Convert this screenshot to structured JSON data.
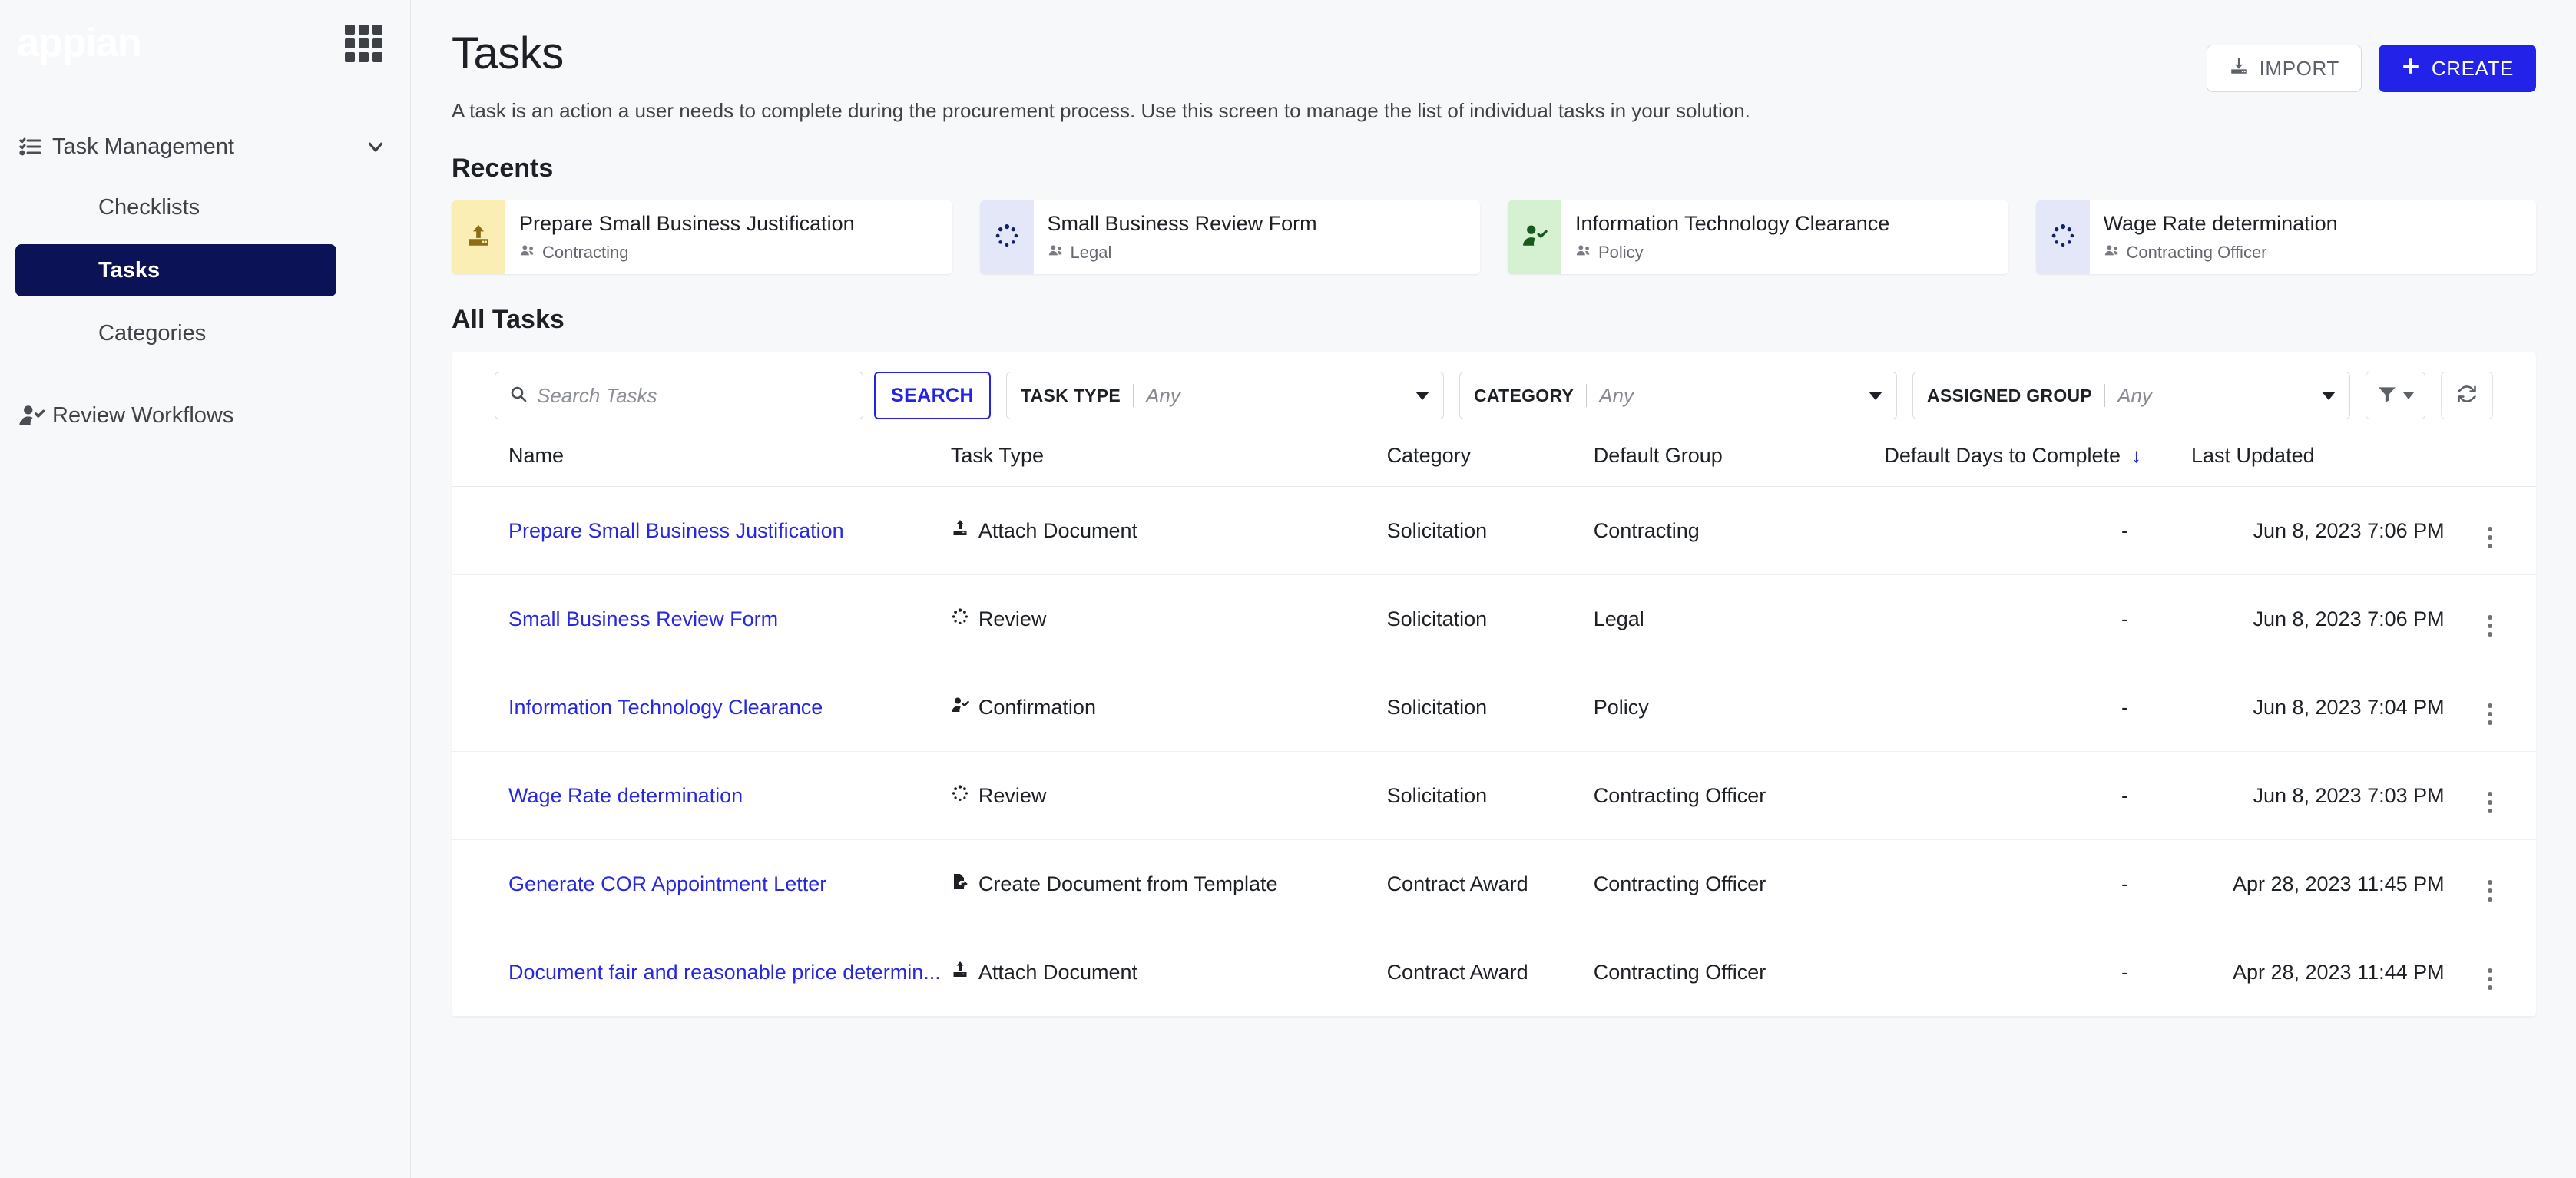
{
  "brand": {
    "name": "appian",
    "accent": "#2222e8",
    "active_nav_bg": "#0b1356"
  },
  "sidebar": {
    "group": {
      "label": "Task Management",
      "icon": "checklist-icon",
      "chevron": "chevron-down-icon"
    },
    "sub_items": [
      {
        "label": "Checklists",
        "active": false
      },
      {
        "label": "Tasks",
        "active": true
      },
      {
        "label": "Categories",
        "active": false
      }
    ],
    "secondary": {
      "label": "Review Workflows",
      "icon": "user-check-icon"
    },
    "apps_icon": "grid-apps-icon"
  },
  "header": {
    "title": "Tasks",
    "description": "A task is an action a user needs to complete during the procurement process. Use this screen to manage the list of individual tasks in your solution.",
    "import_label": "IMPORT",
    "create_label": "CREATE"
  },
  "recents": {
    "title": "Recents",
    "cards": [
      {
        "title": "Prepare Small Business Justification",
        "group": "Contracting",
        "icon": "upload-document-icon",
        "bg": "#fbeeb4",
        "fg": "#8a6d16"
      },
      {
        "title": "Small Business Review Form",
        "group": "Legal",
        "icon": "review-spinner-icon",
        "bg": "#e4e7f8",
        "fg": "#10216e"
      },
      {
        "title": "Information Technology Clearance",
        "group": "Policy",
        "icon": "user-check-icon",
        "bg": "#d6f0d2",
        "fg": "#17591f"
      },
      {
        "title": "Wage Rate determination",
        "group": "Contracting Officer",
        "icon": "review-spinner-icon",
        "bg": "#e4e7f8",
        "fg": "#10216e"
      }
    ]
  },
  "all_tasks": {
    "title": "All Tasks",
    "search": {
      "placeholder": "Search Tasks",
      "value": "",
      "button_label": "SEARCH",
      "icon": "search-icon"
    },
    "filters": [
      {
        "label": "TASK TYPE",
        "value": "Any"
      },
      {
        "label": "CATEGORY",
        "value": "Any"
      },
      {
        "label": "ASSIGNED GROUP",
        "value": "Any"
      }
    ],
    "filter_icon_button": {
      "icon": "funnel-icon",
      "caret": "caret-down-icon"
    },
    "refresh_button": {
      "icon": "refresh-icon"
    },
    "columns": [
      "Name",
      "Task Type",
      "Category",
      "Default Group",
      "Default Days to Complete",
      "Last Updated"
    ],
    "sorted_column": "Default Days to Complete",
    "sort_direction": "down",
    "rows": [
      {
        "name": "Prepare Small Business Justification",
        "task_type": "Attach Document",
        "task_type_icon": "attach-document-icon",
        "category": "Solicitation",
        "default_group": "Contracting",
        "default_days": "-",
        "last_updated": "Jun 8, 2023 7:06 PM"
      },
      {
        "name": "Small Business Review Form",
        "task_type": "Review",
        "task_type_icon": "review-spinner-icon",
        "category": "Solicitation",
        "default_group": "Legal",
        "default_days": "-",
        "last_updated": "Jun 8, 2023 7:06 PM"
      },
      {
        "name": "Information Technology Clearance",
        "task_type": "Confirmation",
        "task_type_icon": "user-check-icon",
        "category": "Solicitation",
        "default_group": "Policy",
        "default_days": "-",
        "last_updated": "Jun 8, 2023 7:04 PM"
      },
      {
        "name": "Wage Rate determination",
        "task_type": "Review",
        "task_type_icon": "review-spinner-icon",
        "category": "Solicitation",
        "default_group": "Contracting Officer",
        "default_days": "-",
        "last_updated": "Jun 8, 2023 7:03 PM"
      },
      {
        "name": "Generate COR Appointment Letter",
        "task_type": "Create Document from Template",
        "task_type_icon": "create-document-icon",
        "category": "Contract Award",
        "default_group": "Contracting Officer",
        "default_days": "-",
        "last_updated": "Apr 28, 2023 11:45 PM"
      },
      {
        "name": "Document fair and reasonable price determin...",
        "task_type": "Attach Document",
        "task_type_icon": "attach-document-icon",
        "category": "Contract Award",
        "default_group": "Contracting Officer",
        "default_days": "-",
        "last_updated": "Apr 28, 2023 11:44 PM"
      }
    ]
  }
}
